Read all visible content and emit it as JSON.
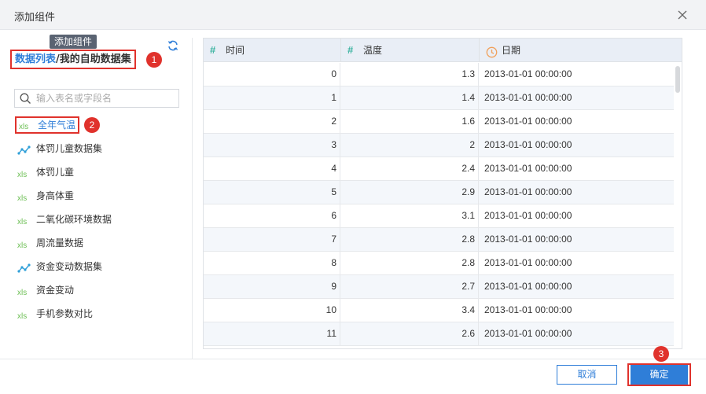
{
  "dialog": {
    "title": "添加组件"
  },
  "left": {
    "tooltip": "添加组件",
    "breadcrumb": {
      "link": "数据列表",
      "sep": "/",
      "current": "我的自助数据集"
    },
    "search": {
      "placeholder": "输入表名或字段名"
    },
    "items": [
      {
        "label": "全年气温",
        "icon": "xls-icon"
      },
      {
        "label": "体罚儿童数据集",
        "icon": "dataset-icon"
      },
      {
        "label": "体罚儿童",
        "icon": "xls-icon"
      },
      {
        "label": "身高体重",
        "icon": "xls-icon"
      },
      {
        "label": "二氧化碳环境数据",
        "icon": "xls-icon"
      },
      {
        "label": "周流量数据",
        "icon": "xls-icon"
      },
      {
        "label": "资金变动数据集",
        "icon": "dataset-icon"
      },
      {
        "label": "资金变动",
        "icon": "xls-icon"
      },
      {
        "label": "手机参数对比",
        "icon": "xls-icon"
      }
    ]
  },
  "badges": {
    "b1": "1",
    "b2": "2",
    "b3": "3"
  },
  "table": {
    "columns": [
      {
        "label": "时间",
        "type_symbol": "#"
      },
      {
        "label": "温度",
        "type_symbol": "#"
      },
      {
        "label": "日期",
        "type_icon": "clock-icon"
      }
    ],
    "rows": [
      [
        "0",
        "1.3",
        "2013-01-01 00:00:00"
      ],
      [
        "1",
        "1.4",
        "2013-01-01 00:00:00"
      ],
      [
        "2",
        "1.6",
        "2013-01-01 00:00:00"
      ],
      [
        "3",
        "2",
        "2013-01-01 00:00:00"
      ],
      [
        "4",
        "2.4",
        "2013-01-01 00:00:00"
      ],
      [
        "5",
        "2.9",
        "2013-01-01 00:00:00"
      ],
      [
        "6",
        "3.1",
        "2013-01-01 00:00:00"
      ],
      [
        "7",
        "2.8",
        "2013-01-01 00:00:00"
      ],
      [
        "8",
        "2.8",
        "2013-01-01 00:00:00"
      ],
      [
        "9",
        "2.7",
        "2013-01-01 00:00:00"
      ],
      [
        "10",
        "3.4",
        "2013-01-01 00:00:00"
      ],
      [
        "11",
        "2.6",
        "2013-01-01 00:00:00"
      ]
    ]
  },
  "footer": {
    "cancel": "取消",
    "ok": "确定"
  },
  "colors": {
    "accent": "#2f7ed8",
    "highlight": "#e0322c",
    "header_bg": "#e9eef6",
    "alt_row": "#f4f7fb"
  }
}
